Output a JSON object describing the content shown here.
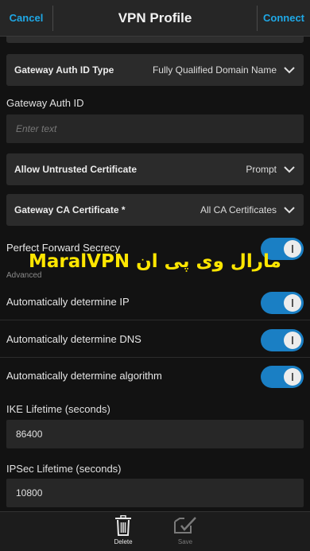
{
  "header": {
    "cancel_label": "Cancel",
    "title": "VPN Profile",
    "connect_label": "Connect"
  },
  "gateway_auth_id_type": {
    "label": "Gateway Auth ID Type",
    "value": "Fully Qualified Domain Name"
  },
  "gateway_auth_id": {
    "label": "Gateway Auth ID",
    "placeholder": "Enter text",
    "value": ""
  },
  "allow_untrusted_certificate": {
    "label": "Allow Untrusted Certificate",
    "value": "Prompt"
  },
  "gateway_ca_certificate": {
    "label": "Gateway CA Certificate *",
    "value": "All CA Certificates"
  },
  "perfect_forward_secrecy": {
    "label": "Perfect Forward Secrecy",
    "on": true
  },
  "watermark": "MaralVPN مارال وی پی ان",
  "advanced": {
    "section_label": "Advanced",
    "auto_ip": {
      "label": "Automatically determine IP",
      "on": true
    },
    "auto_dns": {
      "label": "Automatically determine DNS",
      "on": true
    },
    "auto_algorithm": {
      "label": "Automatically determine algorithm",
      "on": true
    },
    "ike_lifetime": {
      "label": "IKE Lifetime (seconds)",
      "value": "86400"
    },
    "ipsec_lifetime": {
      "label": "IPSec Lifetime (seconds)",
      "value": "10800"
    }
  },
  "footer": {
    "delete_label": "Delete",
    "save_label": "Save"
  },
  "colors": {
    "accent": "#1fa8e6",
    "toggle_on": "#1a7fc4",
    "watermark": "#ffe600",
    "disabled": "#7a7a7a"
  },
  "icons": {
    "chevron": "chevron-down-icon",
    "delete": "trash-icon",
    "save": "save-icon"
  }
}
